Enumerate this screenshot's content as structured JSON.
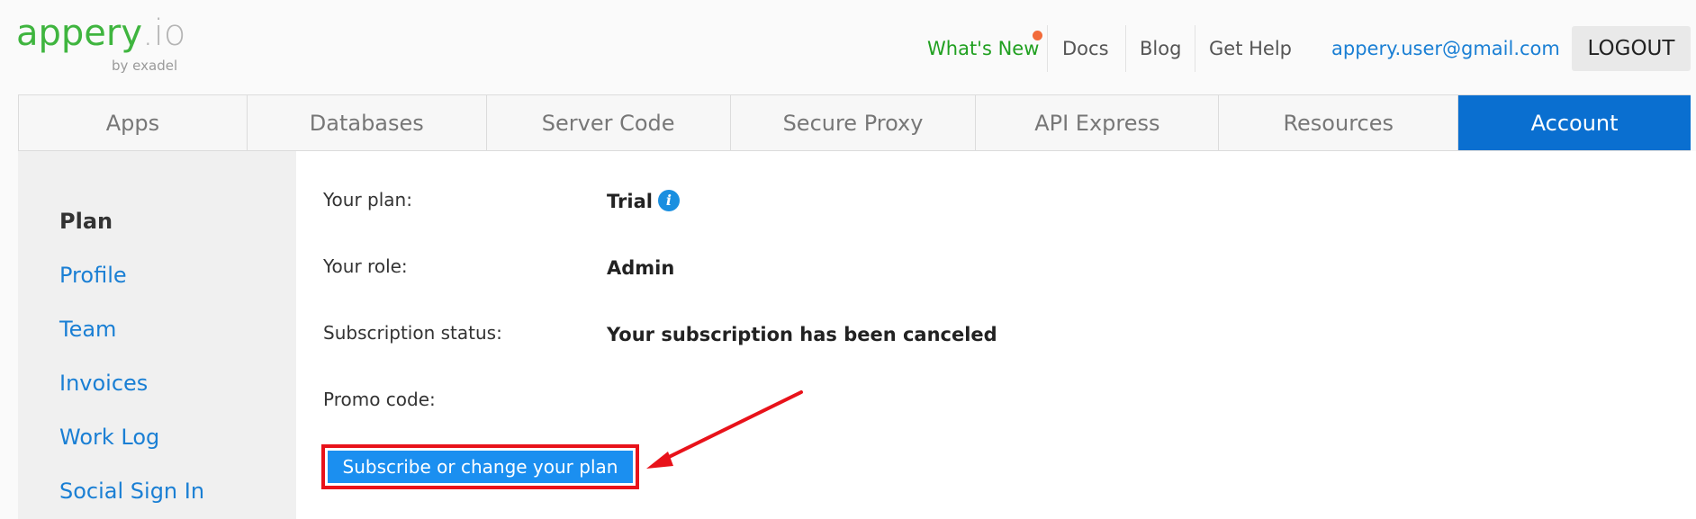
{
  "header": {
    "logo_main": "appery",
    "logo_suffix": ".io",
    "logo_by": "by exadel",
    "nav": {
      "whats_new": "What's New",
      "docs": "Docs",
      "blog": "Blog",
      "get_help": "Get Help",
      "user_email": "appery.user@gmail.com",
      "logout": "LOGOUT"
    }
  },
  "tabs": [
    {
      "label": "Apps"
    },
    {
      "label": "Databases"
    },
    {
      "label": "Server Code"
    },
    {
      "label": "Secure Proxy"
    },
    {
      "label": "API Express"
    },
    {
      "label": "Resources"
    },
    {
      "label": "Account",
      "active": true
    }
  ],
  "sidebar": {
    "items": [
      {
        "label": "Plan",
        "active": true
      },
      {
        "label": "Profile"
      },
      {
        "label": "Team"
      },
      {
        "label": "Invoices"
      },
      {
        "label": "Work Log"
      },
      {
        "label": "Social Sign In"
      }
    ]
  },
  "account": {
    "fields": [
      {
        "label": "Your plan:",
        "value": "Trial"
      },
      {
        "label": "Your role:",
        "value": "Admin"
      },
      {
        "label": "Subscription status:",
        "value": "Your subscription has been canceled"
      },
      {
        "label": "Promo code:",
        "value": ""
      }
    ],
    "info_icon": "info-icon",
    "subscribe_button": "Subscribe or change your plan"
  },
  "colors": {
    "brand_green": "#3fb53f",
    "active_tab": "#0a6fd0",
    "link_blue": "#1a7fd4",
    "button_blue": "#1b8ff0",
    "annotation_red": "#e8121a"
  }
}
